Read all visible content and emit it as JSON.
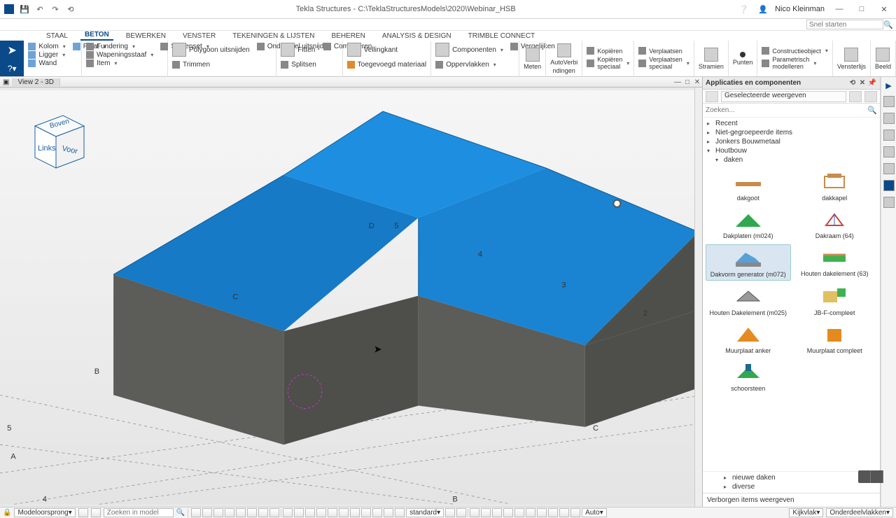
{
  "titlebar": {
    "app": "Tekla Structures",
    "path": "C:\\TeklaStructuresModels\\2020\\Webinar_HSB",
    "user": "Nico Kleinman"
  },
  "quicksearch_placeholder": "Snel starten",
  "tabs": [
    "STAAL",
    "BETON",
    "BEWERKEN",
    "VENSTER",
    "TEKENINGEN & LIJSTEN",
    "BEHEREN",
    "ANALYSIS & DESIGN",
    "TRIMBLE CONNECT"
  ],
  "active_tab": 1,
  "ribbon": {
    "g1": [
      "Kolom",
      "Ligger",
      "Wand",
      "Plaat"
    ],
    "g2": [
      "Fundering",
      "Wapeningsstaaf",
      "Item",
      "Stavenset"
    ],
    "g3_big": "Polygoon uitsnijden",
    "g3": [
      "Trimmen",
      "Onderdeel uitsnijden"
    ],
    "g4_big": "Fitten",
    "g4": [
      "Splitsen",
      "Combineren"
    ],
    "g5_big": "Vellingkant",
    "g5": [
      "Toegevoegd materiaal"
    ],
    "g6_big": "Componenten",
    "g6": [
      "Oppervlakken",
      "Vergelijken"
    ],
    "v1": "Meten",
    "v2": [
      "AutoVerbi",
      "ndingen"
    ],
    "v3a": "Kopiëren",
    "v3b": [
      "Kopiëren",
      "speciaal"
    ],
    "v4a": "Verplaatsen",
    "v4b": [
      "Verplaatsen",
      "speciaal"
    ],
    "v5": "Stramien",
    "v6": "Punten",
    "v7a": "Constructieobject",
    "v7b": [
      "Parametrisch",
      "modelleren"
    ],
    "v8": "Vensterlijs",
    "v9": "Beeld"
  },
  "view_tab": "View 2 - 3D",
  "cube": {
    "top": "Boven",
    "left": "Links",
    "front": "Voor"
  },
  "scene_labels": {
    "A": "A",
    "B": "B",
    "C": "C",
    "D": "D",
    "n2": "2",
    "n3": "3",
    "n4": "4",
    "n5": "5"
  },
  "panel": {
    "title": "Applicaties en componenten",
    "mode": "Geselecteerde weergeven",
    "search_placeholder": "Zoeken...",
    "tree": {
      "recent": "Recent",
      "ungrouped": "Niet-gegroepeerde items",
      "jonkers": "Jonkers Bouwmetaal",
      "houtbouw": "Houtbouw",
      "daken": "daken",
      "nieuwe": "nieuwe daken",
      "diverse": "diverse"
    },
    "items": [
      {
        "label": "dakgoot"
      },
      {
        "label": "dakkapel"
      },
      {
        "label": "Dakplaten (m024)"
      },
      {
        "label": "Dakraam (64)"
      },
      {
        "label": "Dakvorm generator (m072)",
        "selected": true
      },
      {
        "label": "Houten dakelement (63)"
      },
      {
        "label": "Houten Dakelement (m025)"
      },
      {
        "label": "JB-F-compleet"
      },
      {
        "label": "Muurplaat anker"
      },
      {
        "label": "Muurplaat compleet"
      },
      {
        "label": "schoorsteen"
      }
    ],
    "footer": "Verborgen items weergeven"
  },
  "status": {
    "origin": "Modeloorsprong",
    "search_placeholder": "Zoeken in model",
    "combo1": "standard",
    "combo2": "Auto",
    "combo3": "Kijkvlak",
    "combo4": "Onderdeelvlakken"
  }
}
